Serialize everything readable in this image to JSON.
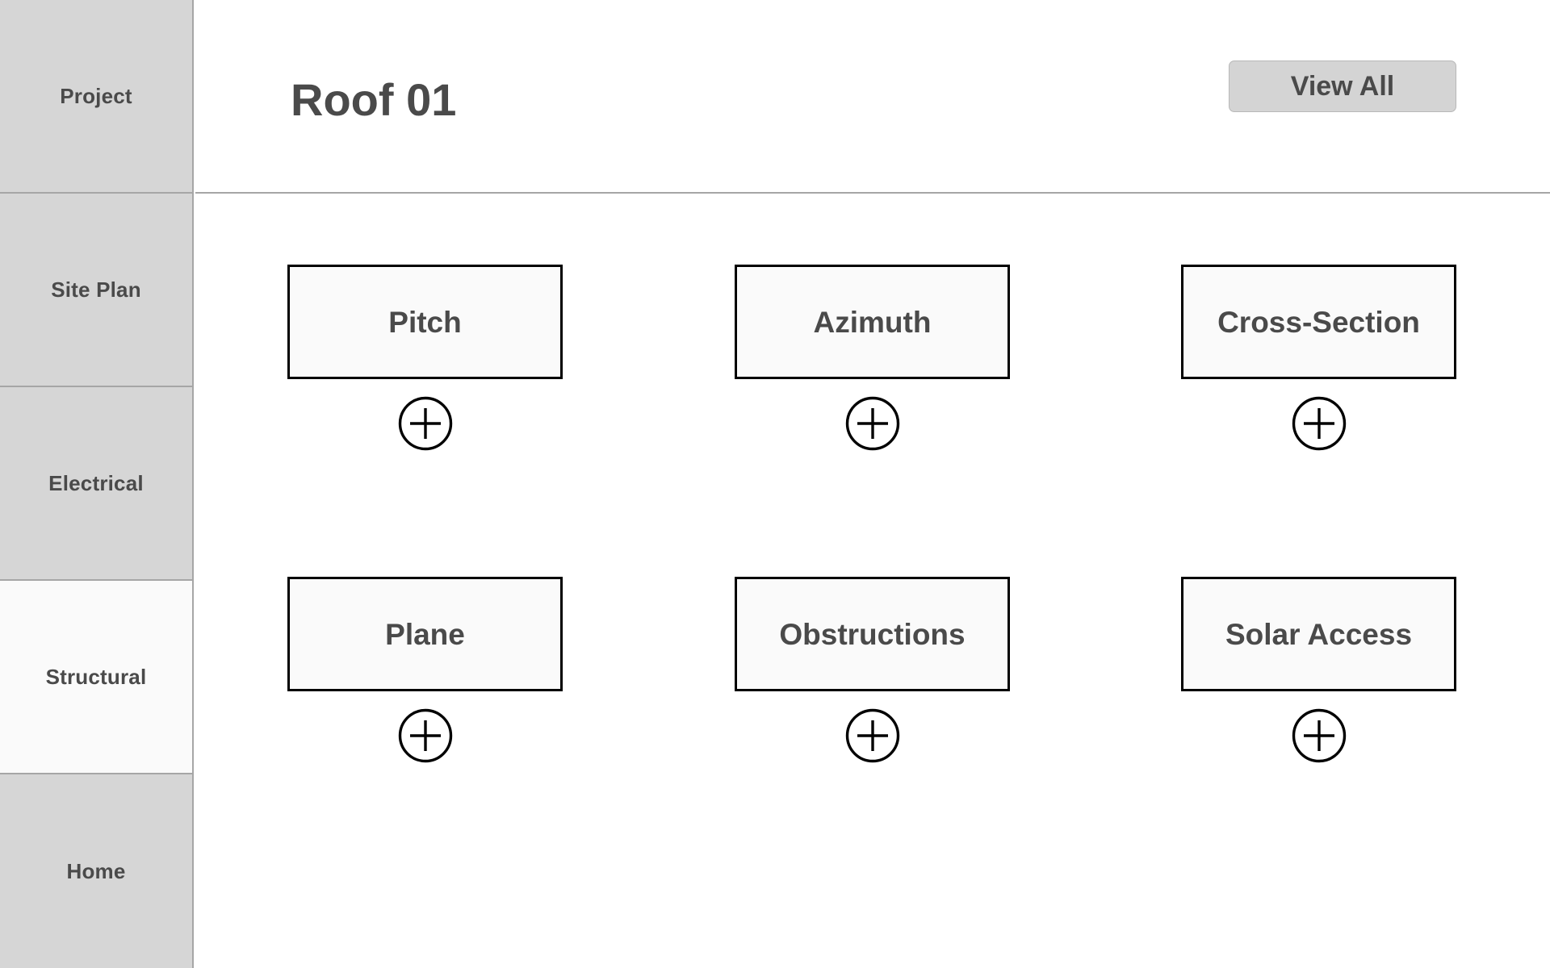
{
  "app": {
    "accent_color": "#4a4a4a",
    "sidebar_bg": "#d6d6d6",
    "sidebar_active_bg": "#fafafa",
    "border_color": "#a6a6a6",
    "card_bg": "#fafafa",
    "card_border": "#000000",
    "button_bg": "#d4d4d4"
  },
  "sidebar": {
    "items": [
      {
        "label": "Project",
        "active": false
      },
      {
        "label": "Site Plan",
        "active": false
      },
      {
        "label": "Electrical",
        "active": false
      },
      {
        "label": "Structural",
        "active": true
      },
      {
        "label": "Home",
        "active": false
      }
    ]
  },
  "header": {
    "title": "Roof 01",
    "view_all_label": "View All"
  },
  "main": {
    "tiles": [
      {
        "label": "Pitch",
        "add_icon": "plus-circle-icon"
      },
      {
        "label": "Azimuth",
        "add_icon": "plus-circle-icon"
      },
      {
        "label": "Cross-Section",
        "add_icon": "plus-circle-icon"
      },
      {
        "label": "Plane",
        "add_icon": "plus-circle-icon"
      },
      {
        "label": "Obstructions",
        "add_icon": "plus-circle-icon"
      },
      {
        "label": "Solar Access",
        "add_icon": "plus-circle-icon"
      }
    ]
  }
}
